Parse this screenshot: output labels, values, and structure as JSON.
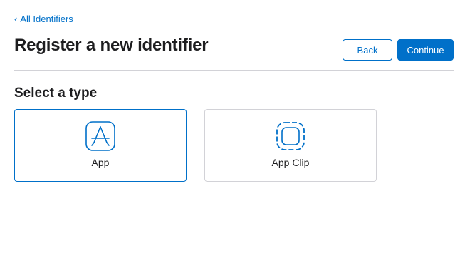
{
  "breadcrumb": {
    "chevron": "‹",
    "label": "All Identifiers"
  },
  "header": {
    "title": "Register a new identifier",
    "back_label": "Back",
    "continue_label": "Continue"
  },
  "section": {
    "title": "Select a type"
  },
  "types": [
    {
      "label": "App",
      "icon": "app-store-icon",
      "selected": true
    },
    {
      "label": "App Clip",
      "icon": "app-clip-icon",
      "selected": false
    }
  ],
  "colors": {
    "accent": "#0070c9",
    "text": "#1d1d1f",
    "border": "#d2d2d7"
  }
}
